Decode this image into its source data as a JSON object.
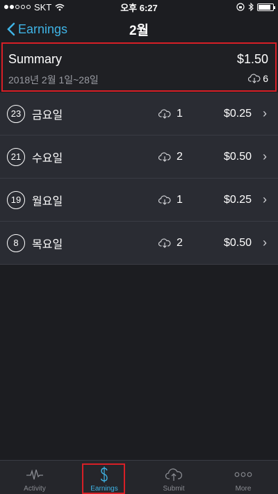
{
  "status_bar": {
    "carrier": "SKT",
    "time": "오후 6:27"
  },
  "nav": {
    "back_label": "Earnings",
    "title": "2월"
  },
  "summary": {
    "title": "Summary",
    "amount": "$1.50",
    "range": "2018년 2월 1일~28일",
    "downloads": "6"
  },
  "rows": [
    {
      "day": "23",
      "weekday": "금요일",
      "downloads": "1",
      "amount": "$0.25"
    },
    {
      "day": "21",
      "weekday": "수요일",
      "downloads": "2",
      "amount": "$0.50"
    },
    {
      "day": "19",
      "weekday": "월요일",
      "downloads": "1",
      "amount": "$0.25"
    },
    {
      "day": "8",
      "weekday": "목요일",
      "downloads": "2",
      "amount": "$0.50"
    }
  ],
  "tabs": [
    {
      "label": "Activity",
      "icon": "activity-icon"
    },
    {
      "label": "Earnings",
      "icon": "dollar-icon",
      "active": true
    },
    {
      "label": "Submit",
      "icon": "upload-icon"
    },
    {
      "label": "More",
      "icon": "more-icon"
    }
  ],
  "colors": {
    "accent": "#3fb4e6",
    "highlight_border": "#d81f26",
    "background": "#1c1d21",
    "row_background": "#2a2c33"
  }
}
